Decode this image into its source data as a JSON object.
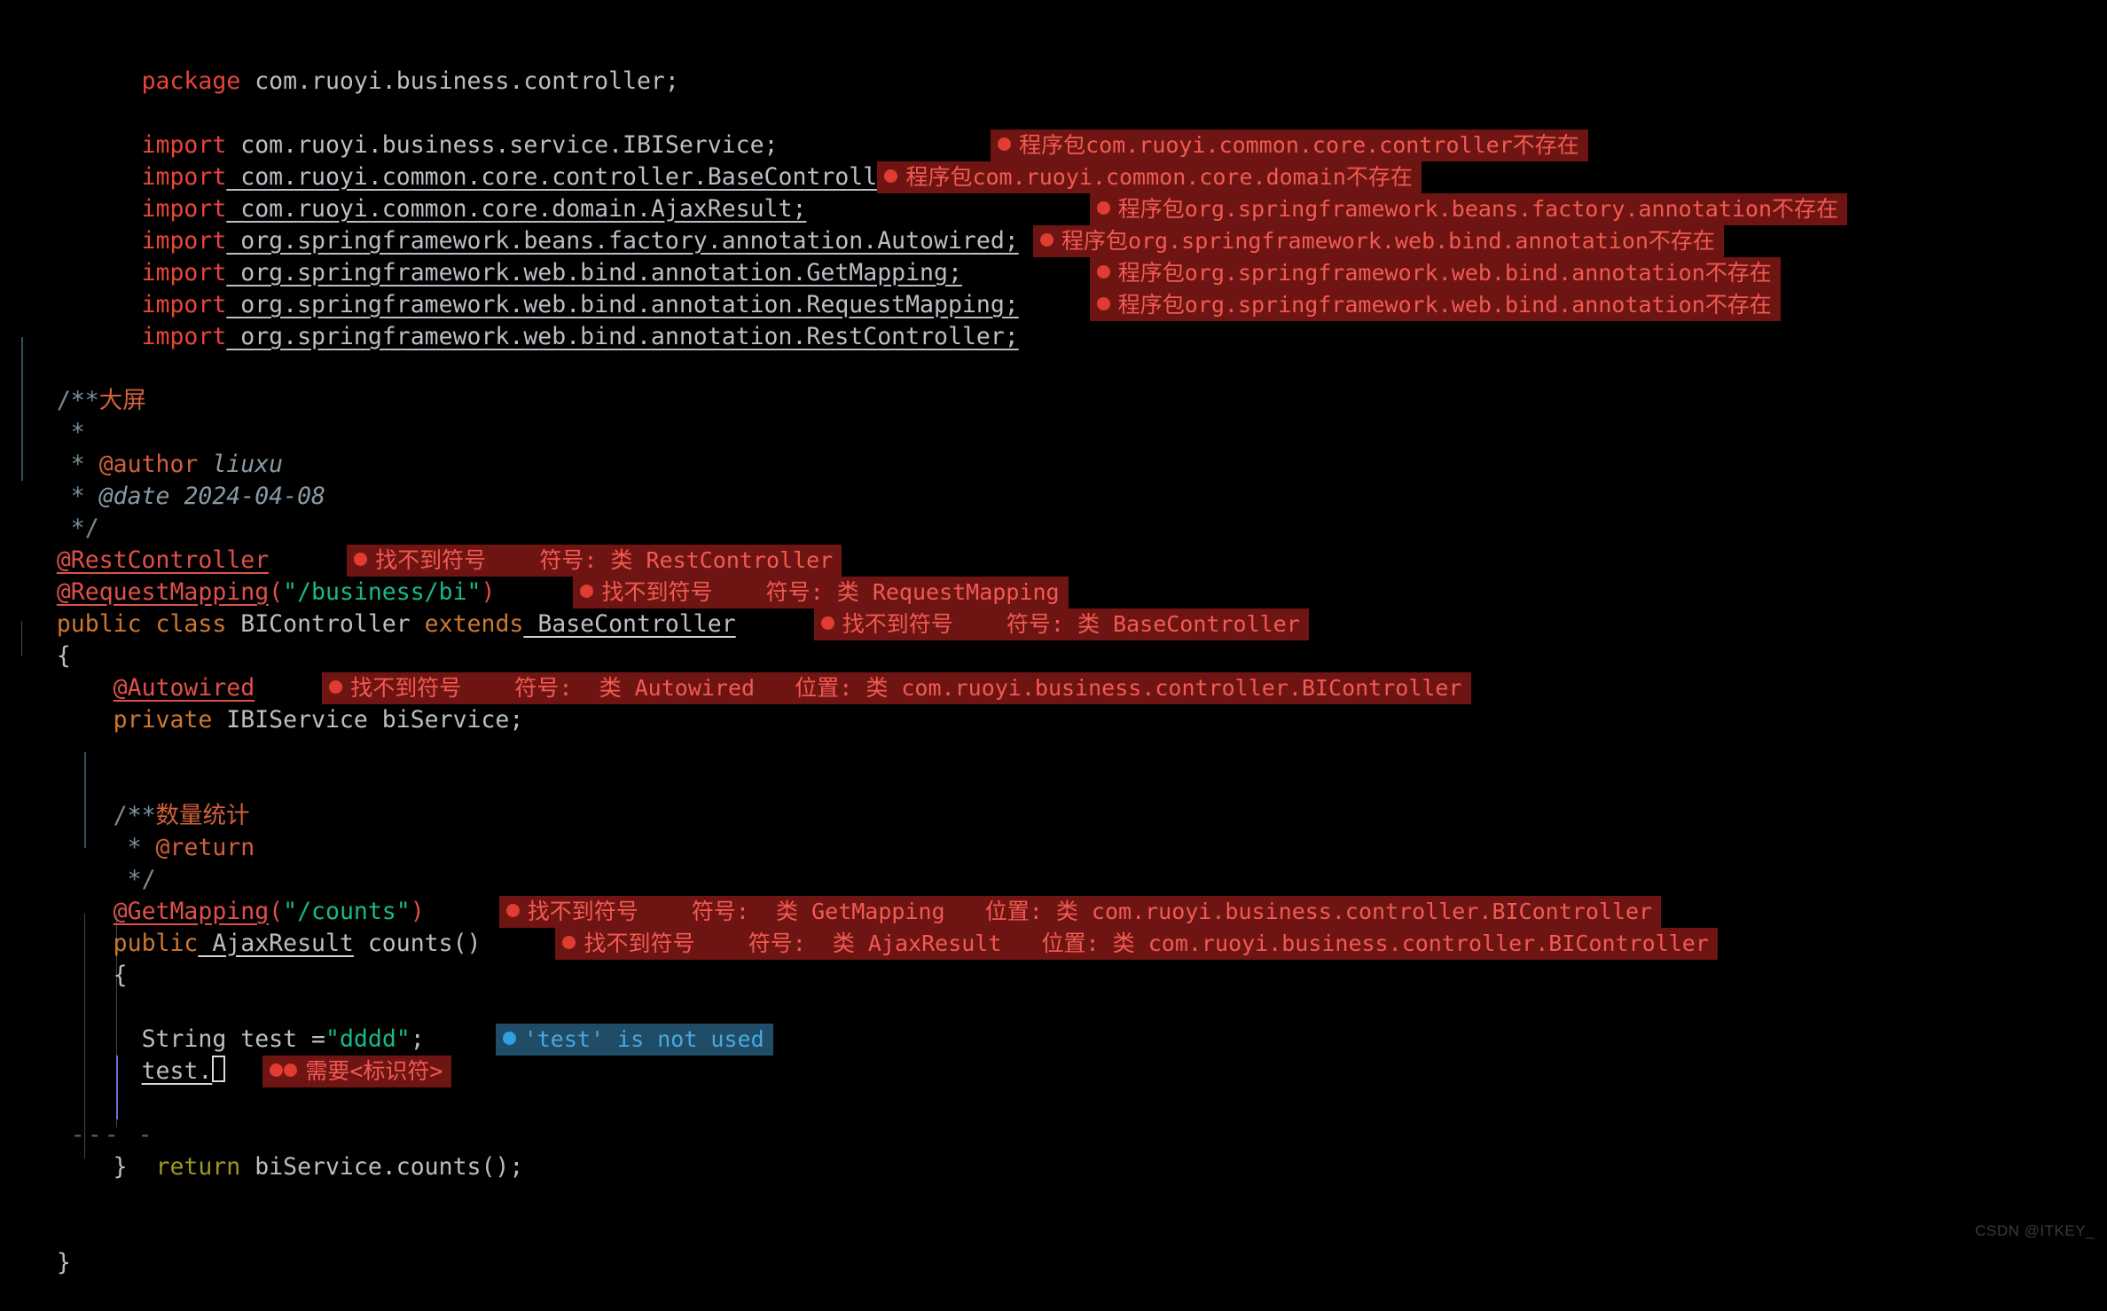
{
  "editor": {
    "language": "java",
    "theme": "dark",
    "background": "#000000",
    "colors": {
      "default_text": "#bcbec4",
      "keyword": "#cc7832",
      "keyword_red": "#e8443a",
      "string": "#19b88a",
      "annotation": "#e0504a",
      "return_keyword": "#9a9a21",
      "comment": "#7a8c99",
      "doc_tag": "#d2603c",
      "error_badge_bg": "#6e1513",
      "error_badge_fg": "#f25a52",
      "warning_badge_bg": "#1f4c66",
      "warning_badge_fg": "#4aa8e0"
    }
  },
  "code": {
    "package_keyword": "package",
    "package_name": " com.ruoyi.business.controller;",
    "import_keyword": "import",
    "imports": [
      {
        "path": " com.ruoyi.business.service.IBIService;",
        "underlined": false
      },
      {
        "path": " com.ruoyi.common.core.controller.BaseController;",
        "underlined": true
      },
      {
        "path": " com.ruoyi.common.core.domain.AjaxResult;",
        "underlined": true
      },
      {
        "path": " org.springframework.beans.factory.annotation.Autowired;",
        "underlined": true
      },
      {
        "path": " org.springframework.web.bind.annotation.GetMapping;",
        "underlined": true
      },
      {
        "path": " org.springframework.web.bind.annotation.RequestMapping;",
        "underlined": true
      },
      {
        "path": " org.springframework.web.bind.annotation.RestController;",
        "underlined": true
      }
    ],
    "class_doc": {
      "open": "/**",
      "star_title_prefix": " * ",
      "title": "大屏",
      "star_blank": " *",
      "star_author_prefix": " * ",
      "author_tag": "@author",
      "author_value": " liuxu",
      "star_date_prefix": " * ",
      "date_tag": "@date",
      "date_value": " 2024-04-08",
      "close": " */"
    },
    "annotation_rest_controller": "@RestController",
    "annotation_request_mapping": "@RequestMapping",
    "request_mapping_open": "(",
    "request_mapping_path": "\"/business/bi\"",
    "request_mapping_close": ")",
    "class_decl_public": "public",
    "class_decl_class": " class",
    "class_decl_name": " BIController",
    "class_decl_extends": " extends",
    "class_decl_super": " BaseController",
    "brace_open": "{",
    "brace_close": "}",
    "annotation_autowired": "@Autowired",
    "field_modifier": "private",
    "field_type": " IBIService",
    "field_name": " biService;",
    "method_doc": {
      "open": "/**",
      "star_title_prefix": " * ",
      "title": "数量统计",
      "star_return_prefix": " * ",
      "return_tag": "@return",
      "close": " */"
    },
    "annotation_get_mapping": "@GetMapping",
    "get_mapping_open": "(",
    "get_mapping_path": "\"/counts\"",
    "get_mapping_close": ")",
    "method_modifier": "public",
    "method_return_type": " AjaxResult",
    "method_signature": " counts()",
    "method_brace_open": "{",
    "method_brace_close": "}",
    "stmt_string_type": "String",
    "stmt_var_name": " test ",
    "stmt_assign": "=",
    "stmt_value": "\"dddd\"",
    "stmt_semicolon": ";",
    "stmt_incomplete": "test.",
    "fold_marker": "--- -",
    "return_keyword": "return",
    "return_expr": " biService.counts();",
    "class_end_brace": "}"
  },
  "annotations": {
    "import_errors": [
      "程序包com.ruoyi.common.core.controller不存在",
      "程序包com.ruoyi.common.core.domain不存在",
      "程序包org.springframework.beans.factory.annotation不存在",
      "程序包org.springframework.web.bind.annotation不存在",
      "程序包org.springframework.web.bind.annotation不存在",
      "程序包org.springframework.web.bind.annotation不存在"
    ],
    "rest_controller_error": "找不到符号    符号: 类 RestController",
    "request_mapping_error": "找不到符号    符号: 类 RequestMapping",
    "base_controller_error": "找不到符号    符号: 类 BaseController",
    "autowired_error": "找不到符号    符号:  类 Autowired   位置: 类 com.ruoyi.business.controller.BIController",
    "get_mapping_error": "找不到符号    符号:  类 GetMapping   位置: 类 com.ruoyi.business.controller.BIController",
    "ajax_result_error": "找不到符号    符号:  类 AjaxResult   位置: 类 com.ruoyi.business.controller.BIController",
    "unused_variable_warning": "'test' is not used",
    "identifier_expected_error": "需要<标识符>"
  },
  "watermark": {
    "text": "CSDN @ITKEY_"
  }
}
